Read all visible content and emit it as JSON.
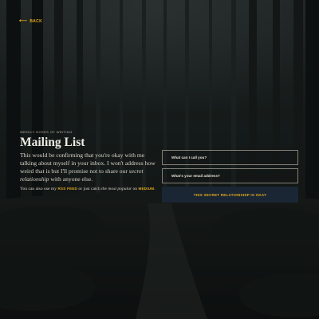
{
  "nav": {
    "back_label": "BACK",
    "back_icon": "arrow-left-icon"
  },
  "intro": {
    "kicker": "WEEKLY DOSES OF WRITING",
    "title": "Mailing List",
    "body_1": "This would be confirming that you're okay with me talking about myself in your inbox. I won't address how weird that is but I'll promise not to share our ",
    "body_em": "secret relationship",
    "body_2": " with anyone else.",
    "aside_1": "You can also use my ",
    "rss_label": "RSS FEED",
    "aside_2": " or just catch ",
    "aside_em": "the most popular",
    "aside_3": " on ",
    "medium_label": "MEDIUM",
    "aside_4": "."
  },
  "form": {
    "name_placeholder": "What can I call you?",
    "email_placeholder": "What's your email address?",
    "submit_label": "THIS SECRET RELATIONSHIP IS OKAY"
  },
  "colors": {
    "accent": "#e0a81b",
    "button_bg": "#1a2634",
    "background": "#121714"
  }
}
